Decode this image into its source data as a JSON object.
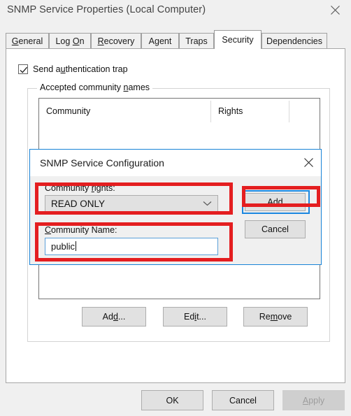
{
  "window": {
    "title": "SNMP Service Properties (Local Computer)",
    "close_icon": "close-icon"
  },
  "tabs": [
    {
      "label": "General",
      "accel": "G",
      "active": false
    },
    {
      "label": "Log On",
      "accel": "O",
      "active": false
    },
    {
      "label": "Recovery",
      "accel": "R",
      "active": false
    },
    {
      "label": "Agent",
      "accel": "g",
      "active": false
    },
    {
      "label": "Traps",
      "accel": "",
      "active": false
    },
    {
      "label": "Security",
      "accel": "",
      "active": true
    },
    {
      "label": "Dependencies",
      "accel": "",
      "active": false
    }
  ],
  "security": {
    "send_auth_trap": {
      "label_before": "Send a",
      "label_accel": "u",
      "label_after": "thentication trap",
      "checked": true,
      "check_icon": "checkmark-icon"
    },
    "group": {
      "title_before": "Accepted community ",
      "title_accel": "n",
      "title_after": "ames"
    },
    "list": {
      "columns": [
        "Community",
        "Rights",
        ""
      ],
      "rows": []
    },
    "buttons": [
      {
        "label_before": "Ad",
        "accel": "d",
        "label_after": "..."
      },
      {
        "label_before": "Ed",
        "accel": "i",
        "label_after": "t..."
      },
      {
        "label_before": "Re",
        "accel": "m",
        "label_after": "ove"
      }
    ]
  },
  "dialog": {
    "title": "SNMP Service Configuration",
    "close_icon": "close-icon",
    "community_rights": {
      "label_before": "Community ",
      "label_accel": "r",
      "label_after": "ights:",
      "value": "READ ONLY",
      "arrow_icon": "chevron-down-icon"
    },
    "community_name": {
      "label_accel": "C",
      "label_after": "ommunity Name:",
      "value": "public",
      "placeholder": ""
    },
    "add_button": {
      "label_before": "",
      "accel": "A",
      "label_after": "dd",
      "focused": true
    },
    "cancel_button": {
      "label": "Cancel"
    }
  },
  "footer": {
    "ok": "OK",
    "cancel": "Cancel",
    "apply": {
      "label_before": "",
      "accel": "A",
      "label_after": "pply",
      "disabled": true
    }
  },
  "annotations": {
    "color": "#e41e20",
    "boxes": [
      "community-rights-highlight",
      "community-name-highlight",
      "add-button-highlight"
    ]
  }
}
